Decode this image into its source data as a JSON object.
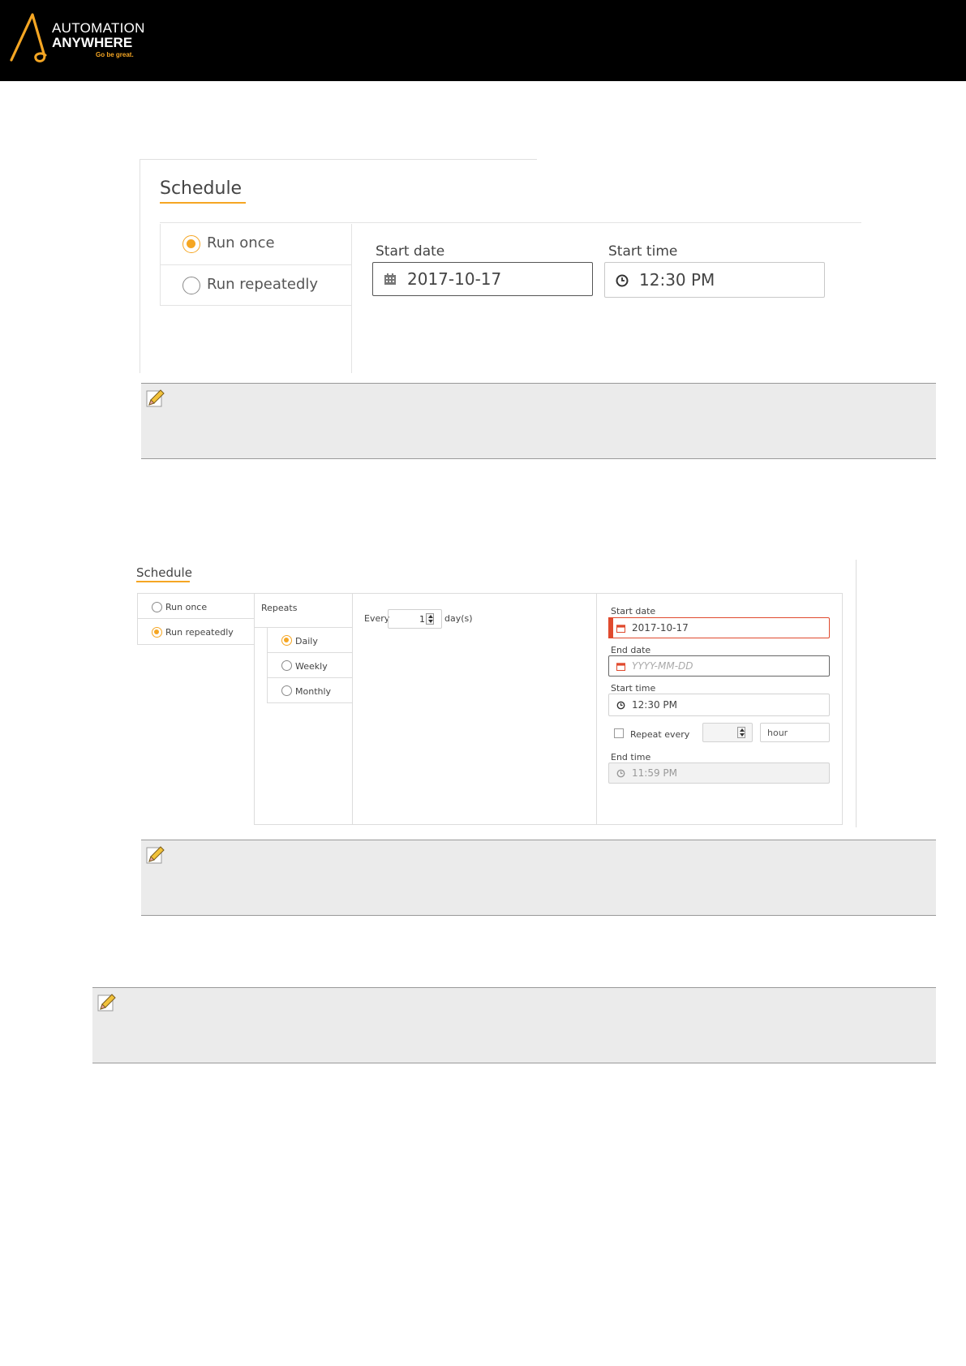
{
  "header": {
    "brand_line1": "AUTOMATION",
    "brand_line2": "ANYWHERE",
    "tagline": "Go be great.",
    "accent_color": "#f5a623"
  },
  "shot1": {
    "title": "Schedule",
    "tabs": [
      {
        "label": "Run once",
        "selected": true
      },
      {
        "label": "Run repeatedly",
        "selected": false
      }
    ],
    "start_date": {
      "label": "Start date",
      "value": "2017-10-17",
      "icon": "calendar-icon"
    },
    "start_time": {
      "label": "Start time",
      "value": "12:30 PM",
      "icon": "clock-icon"
    }
  },
  "shot2": {
    "title": "Schedule",
    "tabs": [
      {
        "label": "Run once",
        "selected": false
      },
      {
        "label": "Run repeatedly",
        "selected": true
      }
    ],
    "repeats_label": "Repeats",
    "repeat_options": [
      {
        "label": "Daily",
        "selected": true
      },
      {
        "label": "Weekly",
        "selected": false
      },
      {
        "label": "Monthly",
        "selected": false
      }
    ],
    "every": {
      "label": "Every",
      "value": "1",
      "unit": "day(s)"
    },
    "start_date": {
      "label": "Start date",
      "value": "2017-10-17"
    },
    "end_date": {
      "label": "End date",
      "placeholder": "YYYY-MM-DD"
    },
    "start_time": {
      "label": "Start time",
      "value": "12:30 PM"
    },
    "repeat_every": {
      "label": "Repeat every",
      "value": "",
      "unit": "hour",
      "checked": false
    },
    "end_time": {
      "label": "End time",
      "value": "11:59 PM"
    },
    "error_color": "#e04a2e"
  }
}
